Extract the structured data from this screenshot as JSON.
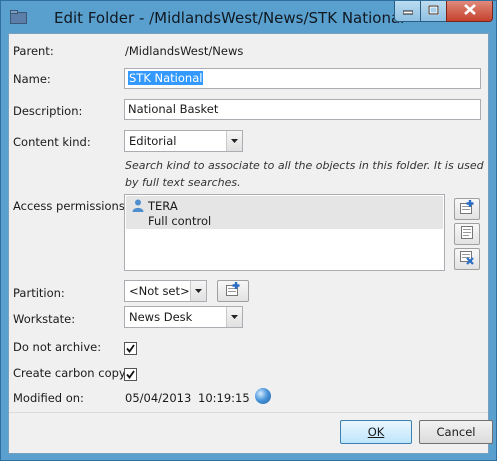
{
  "window": {
    "title": "Edit Folder - /MidlandsWest/News/STK National",
    "controls": [
      "minimize-icon",
      "maximize-icon",
      "close-icon"
    ]
  },
  "form": {
    "parent": {
      "label": "Parent:",
      "value": "/MidlandsWest/News"
    },
    "name": {
      "label": "Name:",
      "value": "STK National"
    },
    "description": {
      "label": "Description:",
      "value": "National Basket"
    },
    "content_kind": {
      "label": "Content kind:",
      "value": "Editorial",
      "hint": "Search kind to associate to all the objects in this folder. It is used by full text searches."
    },
    "access_permissions": {
      "label": "Access permissions:",
      "entries": [
        {
          "name": "TERA",
          "right": "Full control"
        }
      ],
      "buttons": [
        "add-permission-icon",
        "edit-permission-icon",
        "remove-permission-icon"
      ]
    },
    "partition": {
      "label": "Partition:",
      "value": "<Not set>"
    },
    "workstate": {
      "label": "Workstate:",
      "value": "News Desk"
    },
    "do_not_archive": {
      "label": "Do not archive:",
      "checked": true
    },
    "create_carbon_copy": {
      "label": "Create carbon copy:",
      "checked": true
    },
    "modified_on": {
      "label": "Modified on:",
      "date": "05/04/2013",
      "time": "10:19:15"
    }
  },
  "buttons": {
    "ok": "OK",
    "cancel": "Cancel"
  },
  "colors": {
    "titlebar": "#5aa0cf",
    "selection": "#3399ff",
    "close": "#c5412d",
    "dialog": "#f0f0f0"
  }
}
